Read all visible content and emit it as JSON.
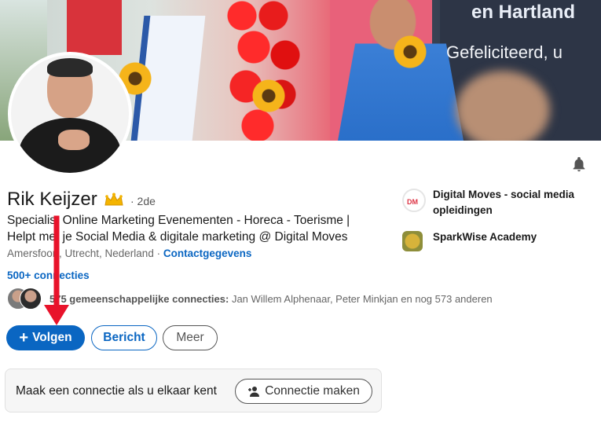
{
  "banner": {
    "board_top": "en Hartland",
    "board_mid": "Gefeliciteerd, u"
  },
  "profile": {
    "name": "Rik Keijzer",
    "degree": "· 2de",
    "headline_line1": "Specialist Online Marketing Evenementen - Horeca - Toerisme |",
    "headline_line2": "Helpt met je Social Media & digitale marketing @ Digital Moves",
    "location": "Amersfoort, Utrecht, Nederland",
    "separator": " · ",
    "contact_link": "Contactgegevens",
    "connections": "500+ connecties",
    "mutual_prefix": "575 gemeenschappelijke connecties:",
    "mutual_rest": " Jan Willem Alphenaar, Peter Minkjan en nog 573 anderen"
  },
  "actions": {
    "follow_label": "Volgen",
    "follow_icon": "plus-icon",
    "message_label": "Bericht",
    "more_label": "Meer"
  },
  "orgs": {
    "org1_line1": "Digital Moves - social media",
    "org1_line2": "opleidingen",
    "org2": "SparkWise Academy"
  },
  "connect_card": {
    "text": "Maak een connectie als u elkaar kent",
    "button_label": "Connectie maken",
    "button_icon": "person-add-icon"
  },
  "colors": {
    "accent": "#0a66c2",
    "annotation_arrow": "#e8132b"
  }
}
